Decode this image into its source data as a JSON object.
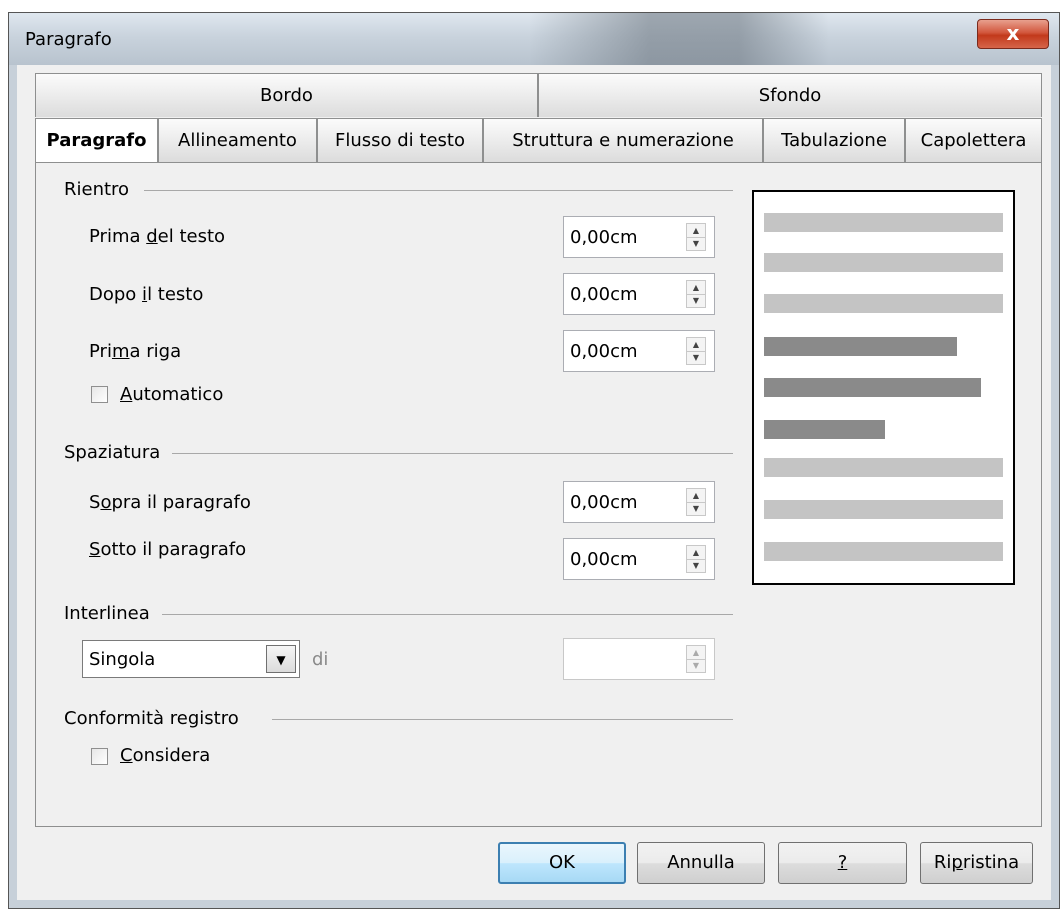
{
  "window": {
    "title": "Paragrafo",
    "close_glyph": "x"
  },
  "tabs_row1": [
    {
      "label": "Bordo"
    },
    {
      "label": "Sfondo"
    }
  ],
  "tabs_row2": [
    {
      "label": "Paragrafo",
      "active": true
    },
    {
      "label": "Allineamento"
    },
    {
      "label": "Flusso di testo"
    },
    {
      "label": "Struttura e numerazione"
    },
    {
      "label": "Tabulazione"
    },
    {
      "label": "Capolettera"
    }
  ],
  "rientro": {
    "heading": "Rientro",
    "before_text": {
      "label_pre": "Prima ",
      "label_ul": "d",
      "label_post": "el testo",
      "value": "0,00cm"
    },
    "after_text": {
      "label_pre": "Dopo ",
      "label_ul": "i",
      "label_post": "l testo",
      "value": "0,00cm"
    },
    "first_line": {
      "label_pre": "Pri",
      "label_ul": "m",
      "label_post": "a riga",
      "value": "0,00cm"
    },
    "automatic": {
      "label_ul": "A",
      "label_post": "utomatico",
      "checked": false
    }
  },
  "spaziatura": {
    "heading": "Spaziatura",
    "above": {
      "label_pre": "S",
      "label_ul": "o",
      "label_post": "pra il paragrafo",
      "value": "0,00cm"
    },
    "below": {
      "label_pre": "",
      "label_ul": "S",
      "label_post": "otto il paragrafo",
      "value": "0,00cm"
    }
  },
  "interlinea": {
    "heading": "Interlinea",
    "selected": "Singola",
    "di_label": "di",
    "value": ""
  },
  "registro": {
    "heading": "Conformità registro",
    "consider": {
      "label_ul": "C",
      "label_post": "onsidera",
      "checked": false
    }
  },
  "buttons": {
    "ok": "OK",
    "cancel": "Annulla",
    "help": "?",
    "reset_pre": "Ri",
    "reset_ul": "p",
    "reset_post": "ristina"
  },
  "colors": {
    "preview_light": "#c4c4c4",
    "preview_dark": "#8a8a8a",
    "close_button": "#c2391b"
  }
}
